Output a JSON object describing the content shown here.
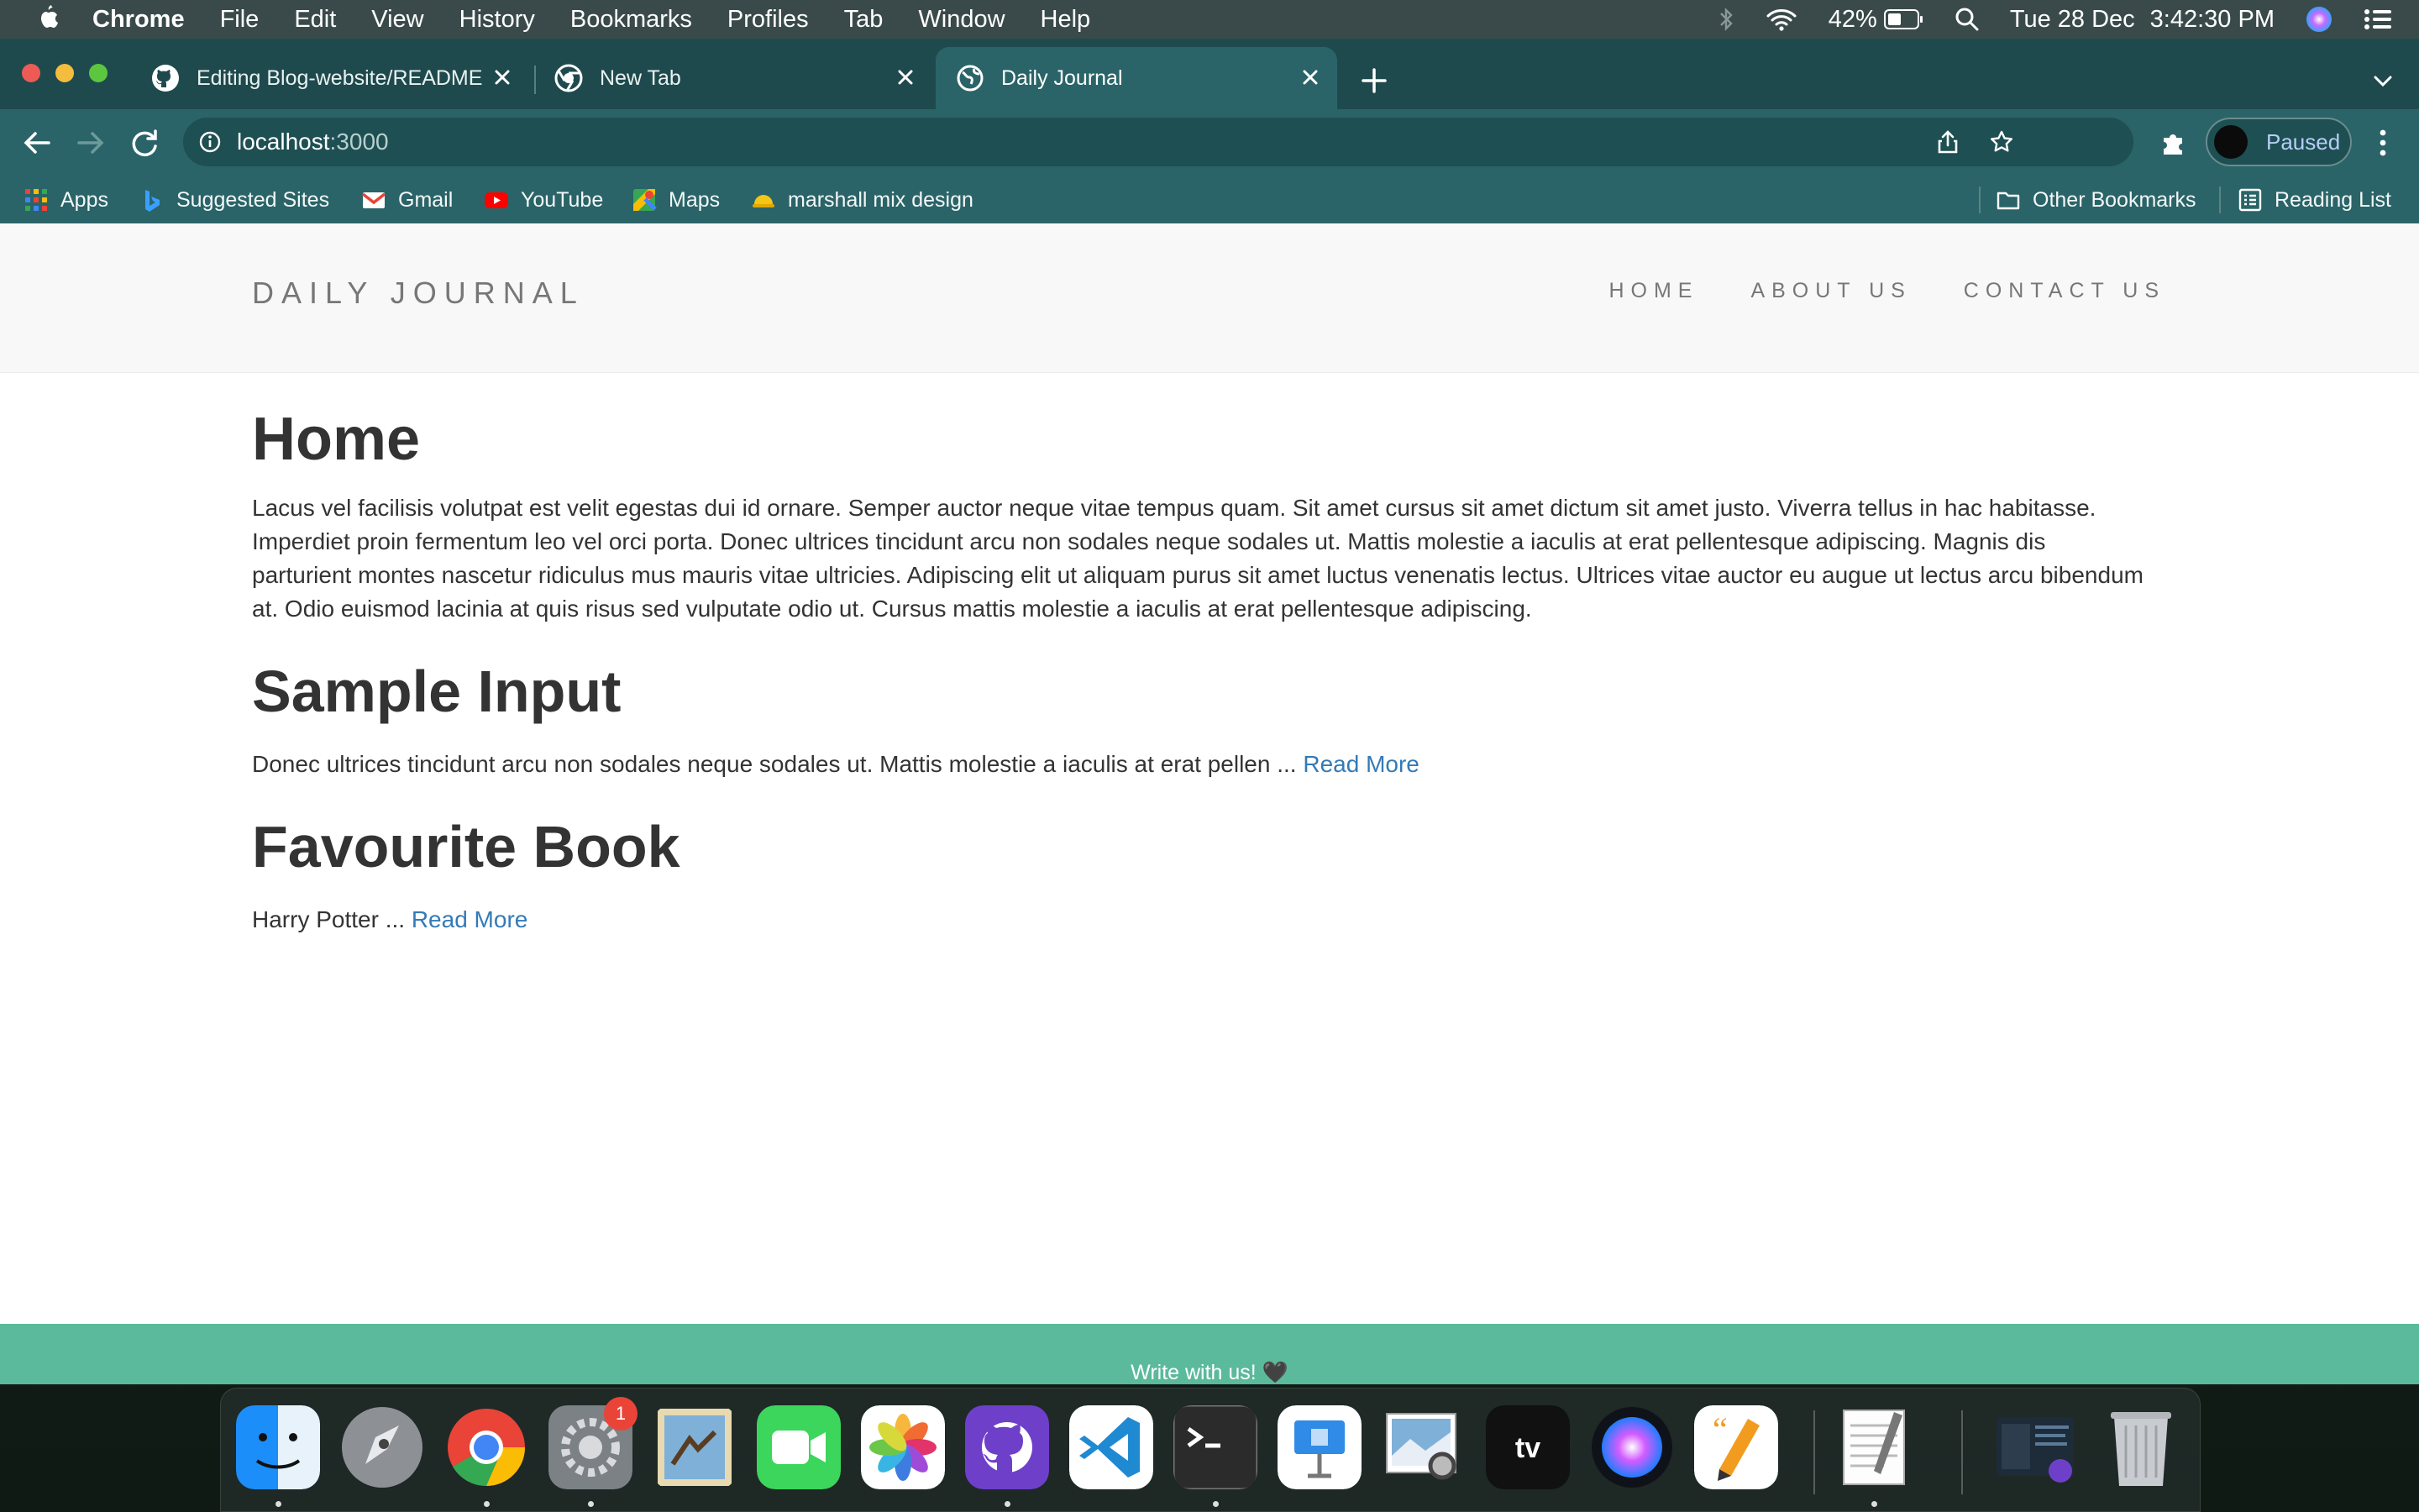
{
  "menubar": {
    "app_name": "Chrome",
    "menus": [
      "File",
      "Edit",
      "View",
      "History",
      "Bookmarks",
      "Profiles",
      "Tab",
      "Window",
      "Help"
    ],
    "battery": "42%",
    "date": "Tue 28 Dec",
    "time": "3:42:30 PM"
  },
  "tabs": [
    {
      "title": "Editing Blog-website/README",
      "icon": "github-icon",
      "active": false
    },
    {
      "title": "New Tab",
      "icon": "chrome-icon",
      "active": false
    },
    {
      "title": "Daily Journal",
      "icon": "globe-icon",
      "active": true
    }
  ],
  "omnibox": {
    "host": "localhost",
    "port": ":3000"
  },
  "profile": {
    "status": "Paused"
  },
  "bookmarks": {
    "items": [
      "Apps",
      "Suggested Sites",
      "Gmail",
      "YouTube",
      "Maps",
      "marshall mix design"
    ],
    "other": "Other Bookmarks",
    "reading_list": "Reading List"
  },
  "site": {
    "brand": "DAILY JOURNAL",
    "nav": [
      "HOME",
      "ABOUT US",
      "CONTACT US"
    ],
    "heading": "Home",
    "intro": "Lacus vel facilisis volutpat est velit egestas dui id ornare. Semper auctor neque vitae tempus quam. Sit amet cursus sit amet dictum sit amet justo. Viverra tellus in hac habitasse. Imperdiet proin fermentum leo vel orci porta. Donec ultrices tincidunt arcu non sodales neque sodales ut. Mattis molestie a iaculis at erat pellentesque adipiscing. Magnis dis parturient montes nascetur ridiculus mus mauris vitae ultricies. Adipiscing elit ut aliquam purus sit amet luctus venenatis lectus. Ultrices vitae auctor eu augue ut lectus arcu bibendum at. Odio euismod lacinia at quis risus sed vulputate odio ut. Cursus mattis molestie a iaculis at erat pellentesque adipiscing.",
    "posts": [
      {
        "title": "Sample Input",
        "excerpt": "Donec ultrices tincidunt arcu non sodales neque sodales ut. Mattis molestie a iaculis at erat pellen ...",
        "link": "Read More"
      },
      {
        "title": "Favourite Book",
        "excerpt": "Harry Potter ...",
        "link": "Read More"
      }
    ],
    "footer": "Write with us! 🖤"
  },
  "dock": {
    "apps": [
      "finder-icon",
      "launchpad-icon",
      "chrome-icon",
      "system-preferences-icon",
      "mail-icon",
      "facetime-icon",
      "photos-icon",
      "github-desktop-icon",
      "vscode-icon",
      "terminal-icon",
      "keynote-icon",
      "preview-icon",
      "apple-tv-icon",
      "siri-icon",
      "pages-icon",
      "textedit-icon",
      "window-preview-icon",
      "trash-icon"
    ],
    "badge": "1"
  }
}
